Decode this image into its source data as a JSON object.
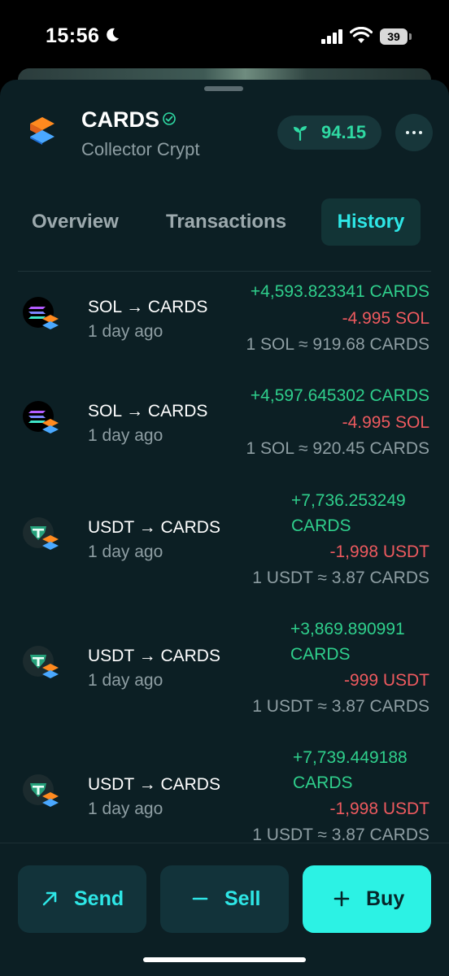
{
  "status_bar": {
    "time": "15:56",
    "battery": "39"
  },
  "token": {
    "name": "CARDS",
    "subtitle": "Collector Crypt",
    "score": "94.15"
  },
  "tabs": [
    {
      "label": "Overview"
    },
    {
      "label": "Transactions"
    },
    {
      "label": "History"
    }
  ],
  "active_tab": "History",
  "history": [
    {
      "pair": "SOL → CARDS",
      "time": "1 day ago",
      "received": "+4,593.823341 CARDS",
      "sent": "-4.995 SOL",
      "rate": "1 SOL ≈ 919.68 CARDS",
      "icon": "sol-to-cards-icon"
    },
    {
      "pair": "SOL → CARDS",
      "time": "1 day ago",
      "received": "+4,597.645302 CARDS",
      "sent": "-4.995 SOL",
      "rate": "1 SOL ≈ 920.45 CARDS",
      "icon": "sol-to-cards-icon"
    },
    {
      "pair": "USDT → CARDS",
      "time": "1 day ago",
      "received_line1": "+7,736.253249",
      "received_line2": "CARDS",
      "sent": "-1,998 USDT",
      "rate": "1 USDT ≈ 3.87 CARDS",
      "icon": "usdt-to-cards-icon"
    },
    {
      "pair": "USDT → CARDS",
      "time": "1 day ago",
      "received_line1": "+3,869.890991",
      "received_line2": "CARDS",
      "sent": "-999 USDT",
      "rate": "1 USDT ≈ 3.87 CARDS",
      "icon": "usdt-to-cards-icon"
    },
    {
      "pair": "USDT → CARDS",
      "time": "1 day ago",
      "received_line1": "+7,739.449188",
      "received_line2": "CARDS",
      "sent": "-1,998 USDT",
      "rate": "1 USDT ≈ 3.87 CARDS",
      "icon": "usdt-to-cards-icon"
    }
  ],
  "actions": {
    "send": "Send",
    "sell": "Sell",
    "buy": "Buy"
  },
  "colors": {
    "accent": "#2ee6e6",
    "positive": "#2fcf8c",
    "negative": "#ee5a5f",
    "sheet_bg": "#0c1f24"
  }
}
